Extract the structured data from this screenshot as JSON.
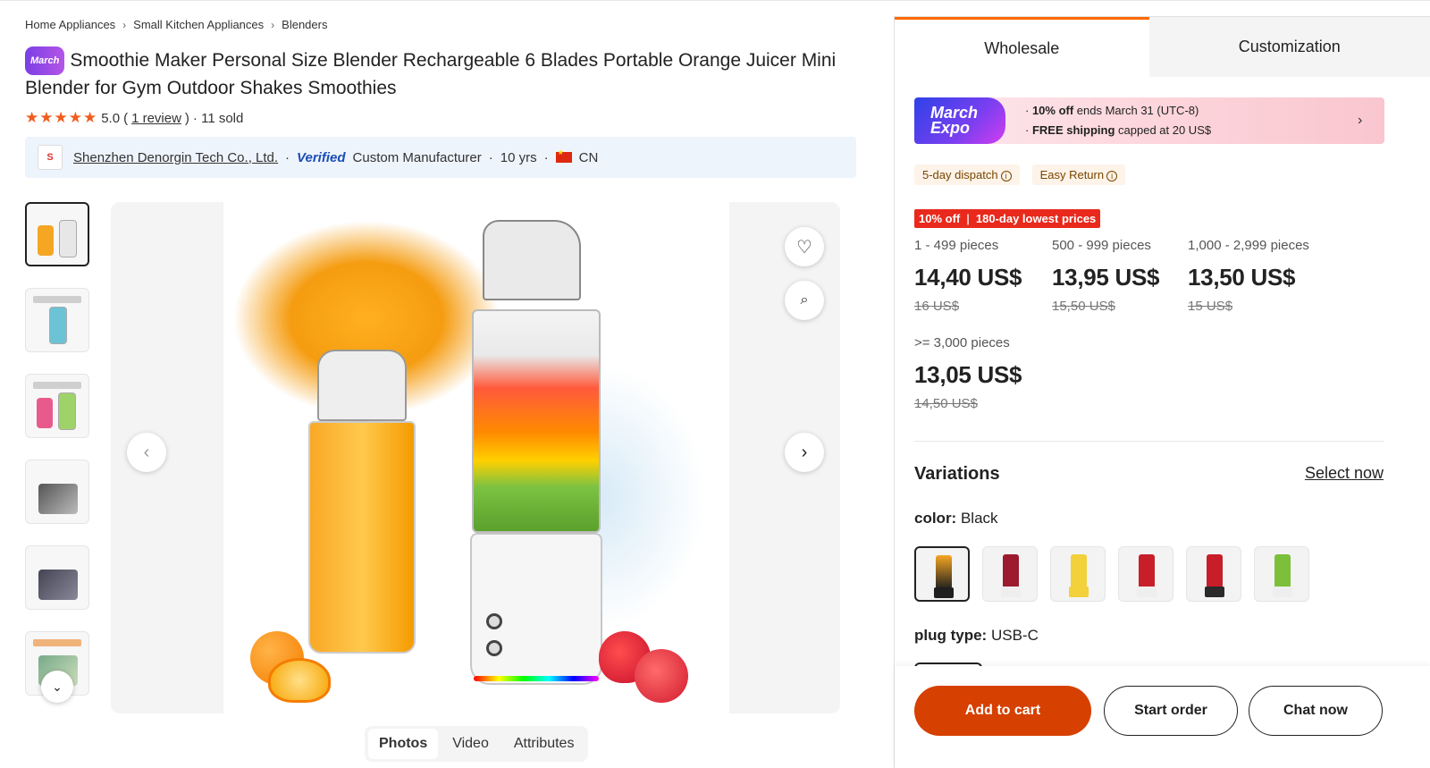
{
  "breadcrumb": [
    "Home Appliances",
    "Small Kitchen Appliances",
    "Blenders"
  ],
  "product": {
    "badge": "March",
    "title": "Smoothie Maker Personal Size Blender Rechargeable 6 Blades Portable Orange Juicer Mini Blender for Gym Outdoor Shakes Smoothies",
    "rating": "5.0",
    "review_link": "1 review",
    "sold": "· 11 sold",
    "stars": "★★★★★"
  },
  "supplier": {
    "name": "Shenzhen Denorgin Tech Co., Ltd.",
    "verified": "Verified",
    "type": "Custom Manufacturer",
    "years": "10 yrs",
    "country": "CN"
  },
  "media_tabs": [
    "Photos",
    "Video",
    "Attributes"
  ],
  "right": {
    "tabs": [
      "Wholesale",
      "Customization"
    ],
    "promo": {
      "logo_line1": "March",
      "logo_line2": "Expo",
      "line1_bold": "10% off",
      "line1_rest": " ends March 31 (UTC-8)",
      "line2_bold": "FREE shipping",
      "line2_rest": " capped at 20 US$"
    },
    "chips": [
      "5-day dispatch",
      "Easy Return"
    ],
    "deal": {
      "left": "10% off",
      "right": "180-day lowest prices"
    },
    "tiers": [
      {
        "qty": "1 - 499 pieces",
        "price": "14,40 US$",
        "old": "16 US$"
      },
      {
        "qty": "500 - 999 pieces",
        "price": "13,95 US$",
        "old": "15,50 US$"
      },
      {
        "qty": "1,000 - 2,999 pieces",
        "price": "13,50 US$",
        "old": "15 US$"
      },
      {
        "qty": ">= 3,000 pieces",
        "price": "13,05 US$",
        "old": "14,50 US$"
      }
    ],
    "variations_title": "Variations",
    "select_now": "Select now",
    "color_label": "color:",
    "color_value": "Black",
    "swatch_colors": [
      "#1f1f1f",
      "#9c1b2e",
      "#f2d13a",
      "#c81e2a",
      "#2a2a2a",
      "#7cbf3a"
    ],
    "plug_label": "plug type:",
    "plug_value": "USB-C",
    "buttons": {
      "cart": "Add to cart",
      "start": "Start order",
      "chat": "Chat now"
    }
  }
}
